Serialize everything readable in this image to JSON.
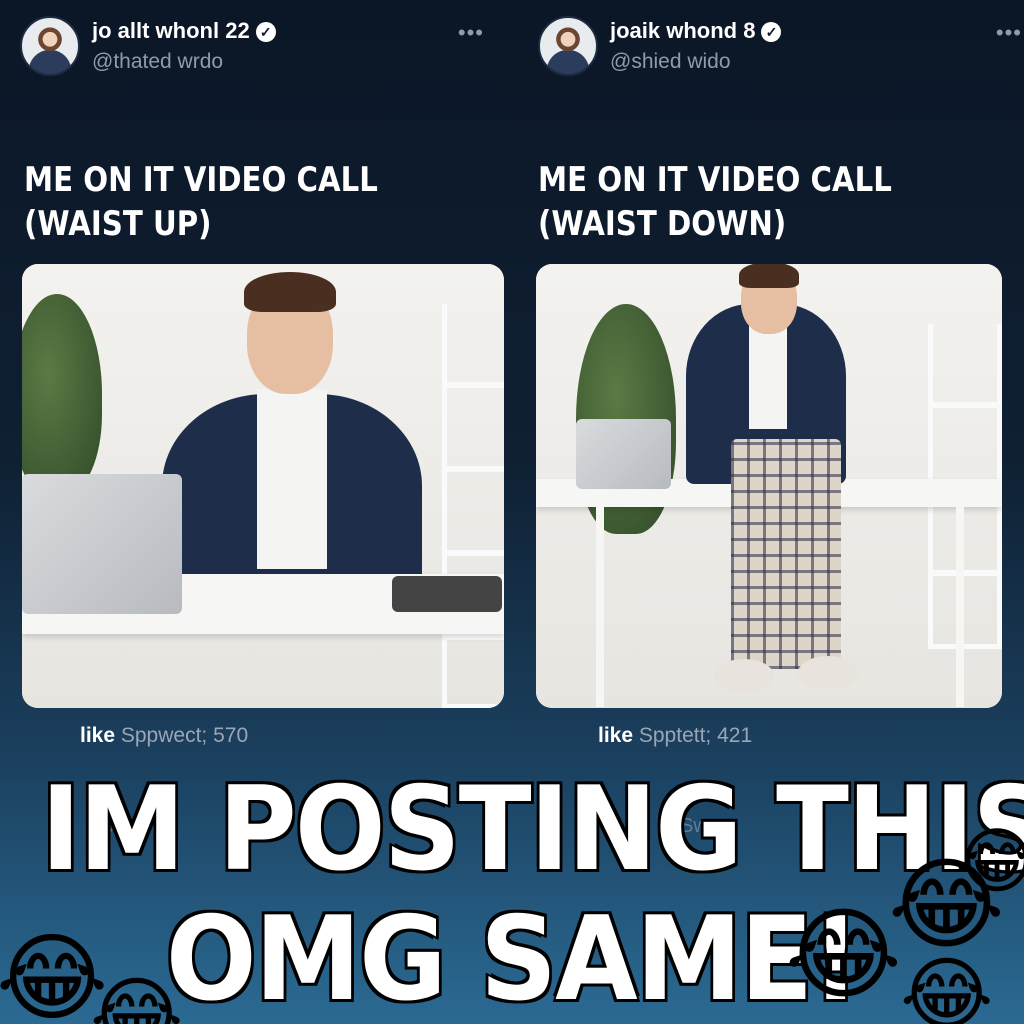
{
  "posts": [
    {
      "display_name": "jo allt whonl 22",
      "username": "@thated wrdo",
      "caption_line1": "ME ON IT VIDEO CALL",
      "caption_line2": "(WAIST UP)",
      "likes_label": "like",
      "likes_text": "Sppwect; 570",
      "faded_text": "Sc"
    },
    {
      "display_name": "joaik whond 8",
      "username": "@shied wido",
      "caption_line1": "ME ON IT VIDEO CALL",
      "caption_line2": "(WAIST DOWN)",
      "likes_label": "like",
      "likes_text": "Spptett; 421",
      "faded_text": "Swe"
    }
  ],
  "overlay": {
    "line1": "IM POSTING THIS",
    "line2": "OMG SAME!"
  },
  "icons": {
    "verified": "verified-badge-icon",
    "more": "more-options-icon",
    "emoji": "laughing-emoji-icon"
  },
  "emoji_glyph": "😂",
  "more_glyph": "•••",
  "verified_glyph": "✓",
  "colors": {
    "background_top": "#0b1626",
    "background_bottom": "#2b6a93",
    "username": "#8e9bab",
    "text": "#ffffff"
  }
}
